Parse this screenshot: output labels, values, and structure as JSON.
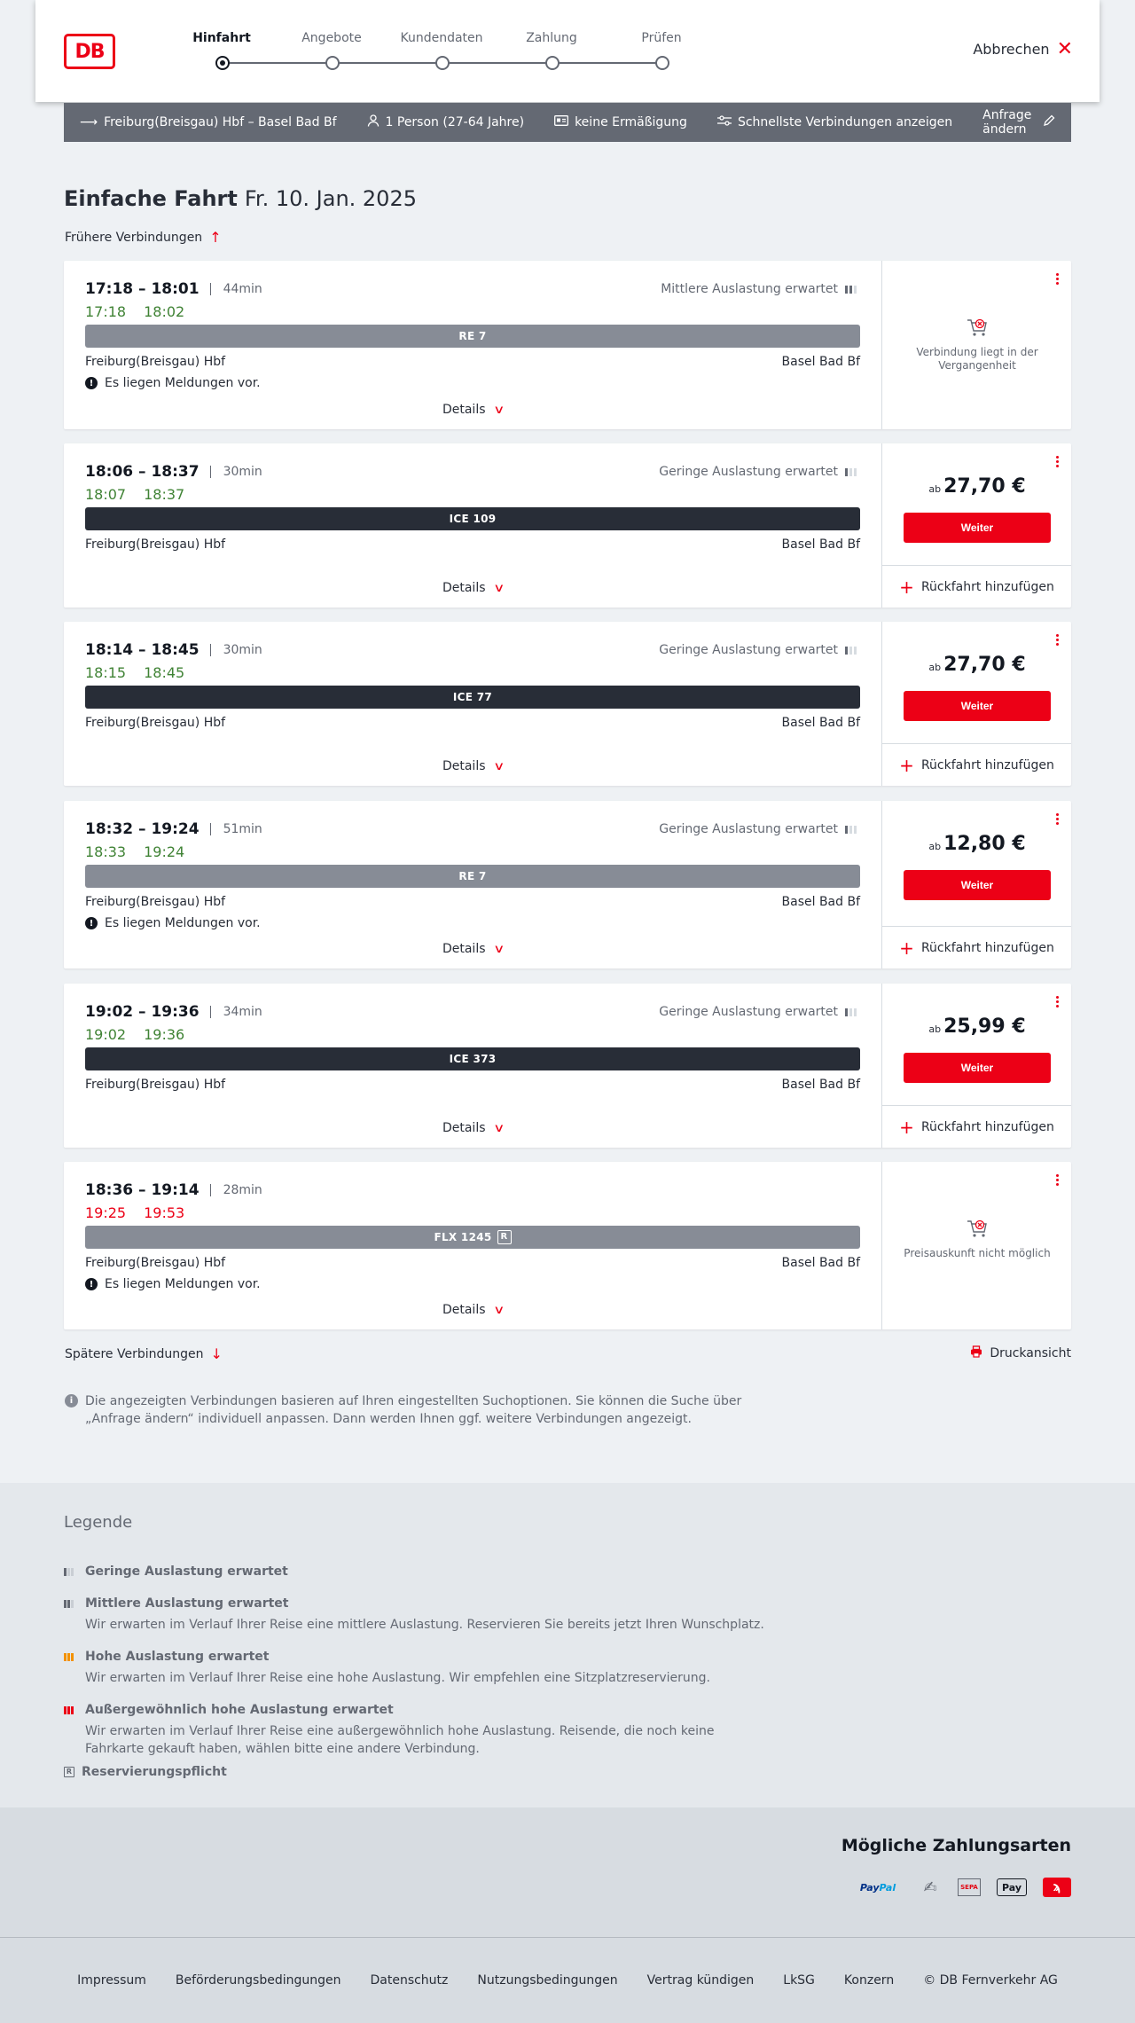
{
  "header": {
    "logo": "DB",
    "steps": [
      {
        "label": "Hinfahrt",
        "active": true
      },
      {
        "label": "Angebote",
        "active": false
      },
      {
        "label": "Kundendaten",
        "active": false
      },
      {
        "label": "Zahlung",
        "active": false
      },
      {
        "label": "Prüfen",
        "active": false
      }
    ],
    "cancel_label": "Abbrechen"
  },
  "query": {
    "route": "Freiburg(Breisgau) Hbf – Basel Bad Bf",
    "persons": "1 Person (27-64 Jahre)",
    "discount": "keine Ermäßigung",
    "fastest": "Schnellste Verbindungen anzeigen",
    "edit": "Anfrage ändern"
  },
  "page": {
    "title": "Einfache Fahrt",
    "date": "Fr. 10. Jan. 2025",
    "earlier": "Frühere Verbindungen",
    "later": "Spätere Verbindungen",
    "print": "Druckansicht",
    "info": "Die angezeigten Verbindungen basieren auf Ihren eingestellten Suchoptionen. Sie können die Suche über „Anfrage ändern“ individuell anpassen. Dann werden Ihnen ggf. weitere Verbindungen angezeigt."
  },
  "labels": {
    "details": "Details",
    "weiter": "Weiter",
    "ab": "ab",
    "return": "Rückfahrt hinzufügen",
    "messages": "Es liegen Meldungen vor."
  },
  "connections": [
    {
      "times": "17:18 – 18:01",
      "duration": "44min",
      "rt_dep": "17:18",
      "rt_arr": "18:02",
      "rt_status": "ontime",
      "load": "Mittlere Auslastung erwartet",
      "load_level": 2,
      "train": "RE 7",
      "train_style": "grey",
      "from": "Freiburg(Breisgau) Hbf",
      "to": "Basel Bad Bf",
      "has_messages": true,
      "price": null,
      "unavailable": "Verbindung liegt in der Vergangenheit"
    },
    {
      "times": "18:06 – 18:37",
      "duration": "30min",
      "rt_dep": "18:07",
      "rt_arr": "18:37",
      "rt_status": "ontime",
      "load": "Geringe Auslastung erwartet",
      "load_level": 1,
      "train": "ICE 109",
      "train_style": "dark",
      "from": "Freiburg(Breisgau) Hbf",
      "to": "Basel Bad Bf",
      "has_messages": false,
      "price": "27,70 €",
      "unavailable": null
    },
    {
      "times": "18:14 – 18:45",
      "duration": "30min",
      "rt_dep": "18:15",
      "rt_arr": "18:45",
      "rt_status": "ontime",
      "load": "Geringe Auslastung erwartet",
      "load_level": 1,
      "train": "ICE 77",
      "train_style": "dark",
      "from": "Freiburg(Breisgau) Hbf",
      "to": "Basel Bad Bf",
      "has_messages": false,
      "price": "27,70 €",
      "unavailable": null
    },
    {
      "times": "18:32 – 19:24",
      "duration": "51min",
      "rt_dep": "18:33",
      "rt_arr": "19:24",
      "rt_status": "ontime",
      "load": "Geringe Auslastung erwartet",
      "load_level": 1,
      "train": "RE 7",
      "train_style": "grey",
      "from": "Freiburg(Breisgau) Hbf",
      "to": "Basel Bad Bf",
      "has_messages": true,
      "price": "12,80 €",
      "unavailable": null
    },
    {
      "times": "19:02 – 19:36",
      "duration": "34min",
      "rt_dep": "19:02",
      "rt_arr": "19:36",
      "rt_status": "ontime",
      "load": "Geringe Auslastung erwartet",
      "load_level": 1,
      "train": "ICE 373",
      "train_style": "dark",
      "from": "Freiburg(Breisgau) Hbf",
      "to": "Basel Bad Bf",
      "has_messages": false,
      "price": "25,99 €",
      "unavailable": null
    },
    {
      "times": "18:36 – 19:14",
      "duration": "28min",
      "rt_dep": "19:25",
      "rt_arr": "19:53",
      "rt_status": "late",
      "load": "",
      "load_level": 0,
      "train": "FLX 1245",
      "train_style": "grey",
      "reservation_icon": "R",
      "from": "Freiburg(Breisgau) Hbf",
      "to": "Basel Bad Bf",
      "has_messages": true,
      "price": null,
      "unavailable": "Preisauskunft nicht möglich"
    }
  ],
  "legend": {
    "title": "Legende",
    "items": [
      {
        "icon": "low-load-icon",
        "label": "Geringe Auslastung erwartet",
        "desc": ""
      },
      {
        "icon": "medium-load-icon",
        "label": "Mittlere Auslastung erwartet",
        "desc": "Wir erwarten im Verlauf Ihrer Reise eine mittlere Auslastung. Reservieren Sie bereits jetzt Ihren Wunschplatz."
      },
      {
        "icon": "high-load-icon",
        "label": "Hohe Auslastung erwartet",
        "desc": "Wir erwarten im Verlauf Ihrer Reise eine hohe Auslastung. Wir empfehlen eine Sitzplatzreservierung."
      },
      {
        "icon": "extreme-load-icon",
        "label": "Außergewöhnlich hohe Auslastung erwartet",
        "desc": "Wir erwarten im Verlauf Ihrer Reise eine außergewöhnlich hohe Auslastung. Reisende, die noch keine Fahrkarte gekauft haben, wählen bitte eine andere Verbindung."
      },
      {
        "icon": "reservation-required-icon",
        "label": "Reservierungspflicht",
        "desc": ""
      }
    ]
  },
  "payments": {
    "title": "Mögliche Zahlungsarten",
    "paypal_a": "Pay",
    "paypal_b": "Pal",
    "sepa": "SEPA",
    "apple": "Pay"
  },
  "footer": {
    "links": [
      "Impressum",
      "Beförderungsbedingungen",
      "Datenschutz",
      "Nutzungsbedingungen",
      "Vertrag kündigen",
      "LkSG",
      "Konzern",
      "© DB Fernverkehr AG"
    ]
  },
  "colors": {
    "brand": "#ec0016",
    "ontime": "#408335",
    "late": "#ec0016",
    "bar_dark": "#282d37",
    "bar_grey": "#878c96"
  }
}
